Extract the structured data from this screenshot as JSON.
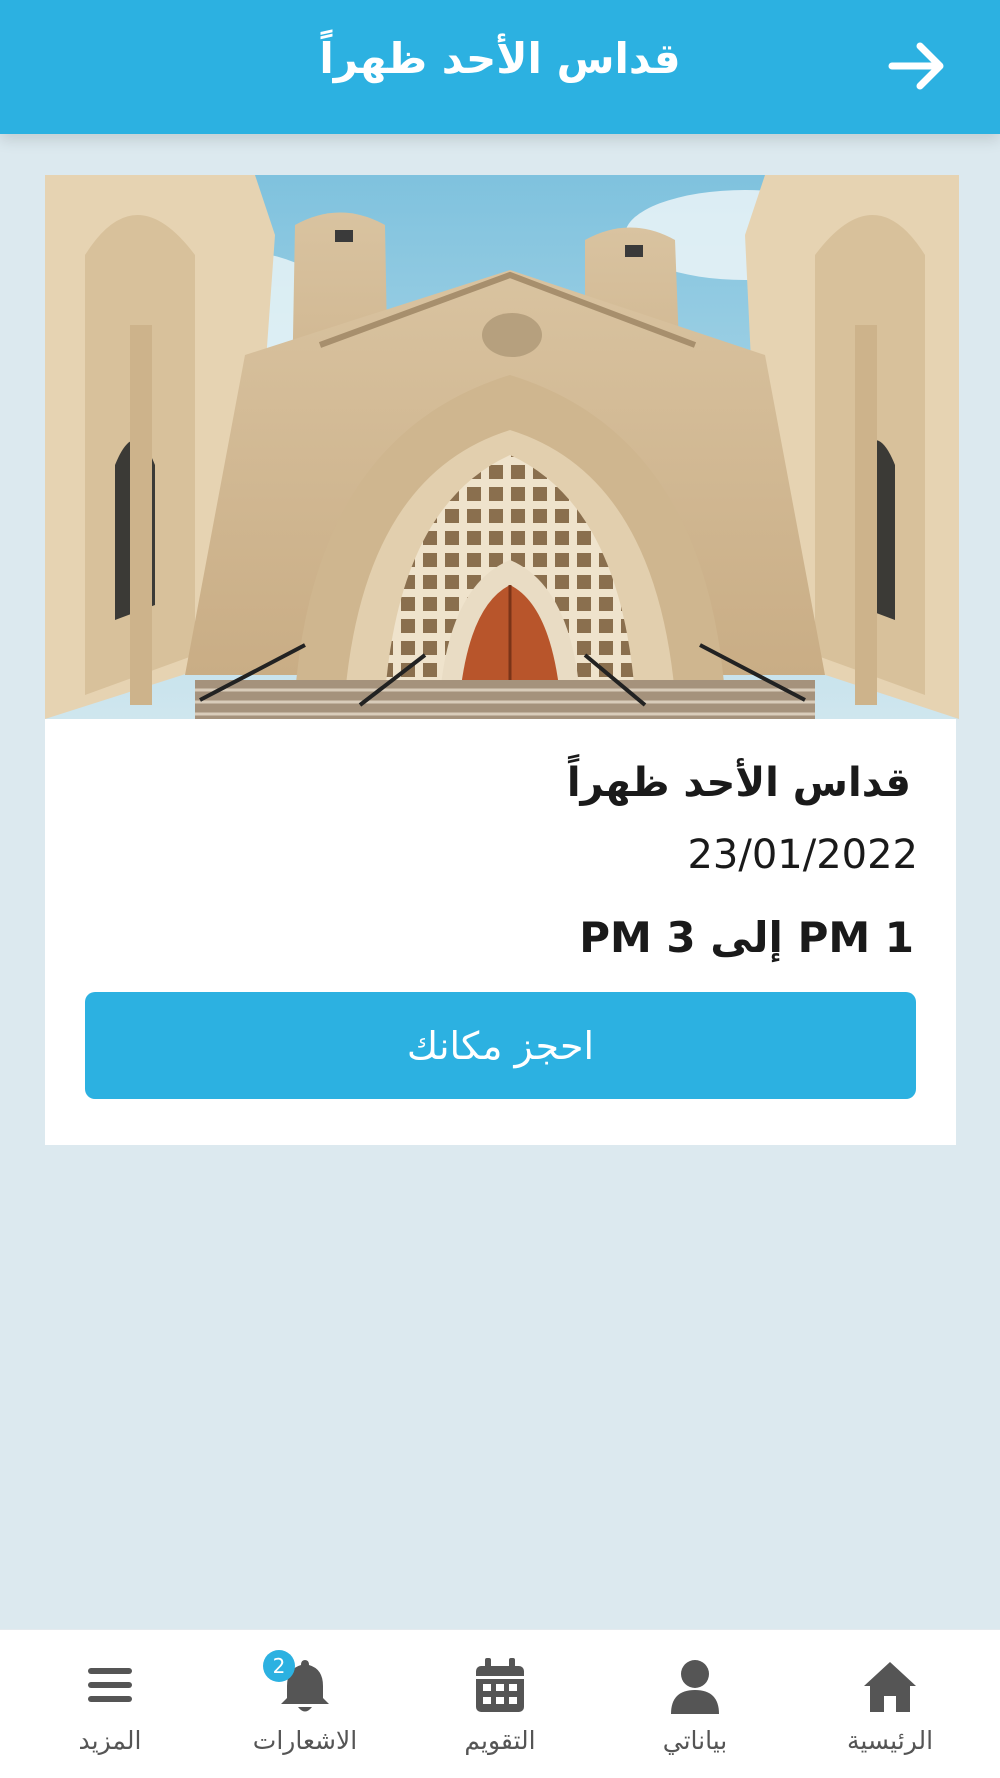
{
  "header": {
    "title": "قداس الأحد ظهراً",
    "back_icon": "arrow-right-icon"
  },
  "event": {
    "image": "church-facade-photo",
    "title": "قداس الأحد ظهراً",
    "date": "23/01/2022",
    "time": "1 PM إلى 3 PM",
    "book_label": "احجز مكانك"
  },
  "tabbar": {
    "items": [
      {
        "label": "الرئيسية",
        "icon": "home-icon"
      },
      {
        "label": "بياناتي",
        "icon": "user-icon"
      },
      {
        "label": "التقويم",
        "icon": "calendar-icon"
      },
      {
        "label": "الاشعارات",
        "icon": "bell-icon",
        "badge": "2"
      },
      {
        "label": "المزيد",
        "icon": "menu-icon"
      }
    ]
  },
  "colors": {
    "accent": "#2cb1e1",
    "background": "#dce9ef",
    "icon": "#555555"
  }
}
